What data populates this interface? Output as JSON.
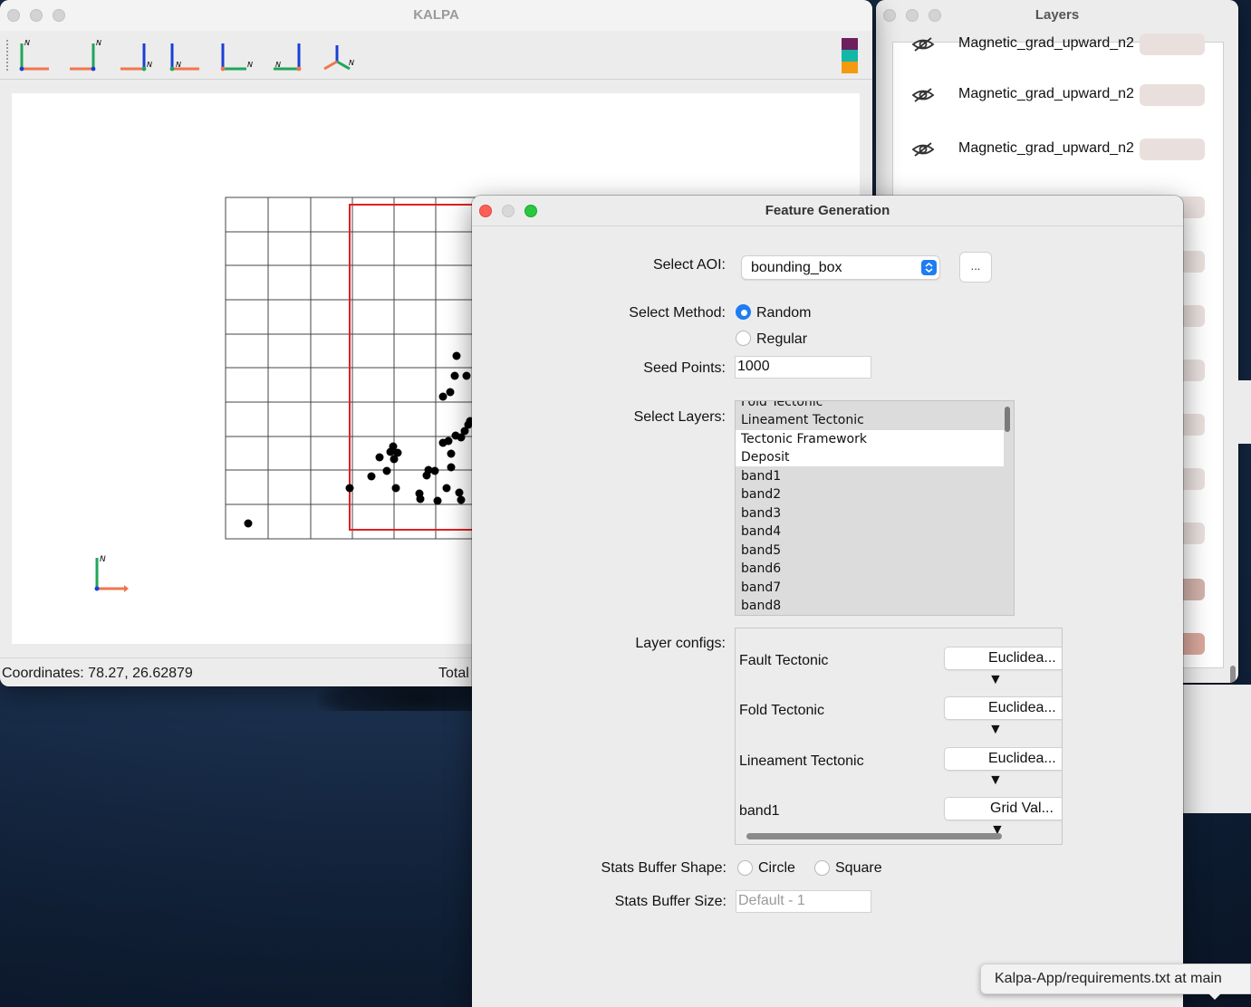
{
  "kalpa_window": {
    "title": "KALPA",
    "toolbar_tools": [
      {
        "name": "orientation-view-1-icon"
      },
      {
        "name": "orientation-view-2-icon"
      },
      {
        "name": "orientation-view-3-icon"
      },
      {
        "name": "orientation-view-4-icon"
      },
      {
        "name": "orientation-view-5-icon"
      },
      {
        "name": "orientation-view-6-icon"
      },
      {
        "name": "orientation-view-3d-icon"
      }
    ],
    "axis_north_label": "N",
    "color_swatch": [
      "#6e1f5d",
      "#13b7a8",
      "#f39a10"
    ],
    "status": {
      "coordinates": "Coordinates: 78.27, 26.62879",
      "total": "Total"
    }
  },
  "layers_window": {
    "title": "Layers",
    "rows": [
      {
        "label": "Magnetic_grad_upward_n2"
      },
      {
        "label": "Magnetic_grad_upward_n2"
      },
      {
        "label": "Magnetic_grad_upward_n2"
      }
    ]
  },
  "feature_dialog": {
    "title": "Feature Generation",
    "aoi": {
      "label": "Select AOI:",
      "value": "bounding_box",
      "more_button": "..."
    },
    "method": {
      "label": "Select Method:",
      "options": [
        "Random",
        "Regular"
      ],
      "selected": "Random"
    },
    "seed_points": {
      "label": "Seed Points:",
      "value": "1000"
    },
    "layers": {
      "label": "Select Layers:",
      "items": [
        "Fold Tectonic",
        "Lineament Tectonic",
        "Tectonic Framework",
        "Deposit",
        "band1",
        "band2",
        "band3",
        "band4",
        "band5",
        "band6",
        "band7",
        "band8"
      ]
    },
    "layer_configs": {
      "label": "Layer configs:",
      "rows": [
        {
          "name": "Fault Tectonic",
          "value": "Euclidea... ▼"
        },
        {
          "name": "Fold Tectonic",
          "value": "Euclidea... ▼"
        },
        {
          "name": "Lineament Tectonic",
          "value": "Euclidea... ▼"
        },
        {
          "name": "band1",
          "value": "Grid Val... ▼"
        }
      ]
    },
    "buffer_shape": {
      "label": "Stats Buffer Shape:",
      "options": [
        "Circle",
        "Square"
      ]
    },
    "buffer_size": {
      "label": "Stats Buffer Size:",
      "placeholder": "Default - 1"
    }
  },
  "tooltip": {
    "text": "Kalpa-App/requirements.txt at main"
  }
}
